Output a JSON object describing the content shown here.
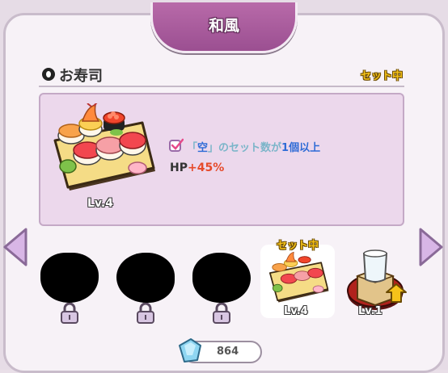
{
  "header": {
    "title": "和風"
  },
  "section": {
    "title": "お寿司",
    "status_badge": "セット中"
  },
  "detail": {
    "level": "Lv.4",
    "condition_open": "「",
    "condition_key": "空",
    "condition_mid": "」のセット数が",
    "condition_count": "1個以上",
    "bonus_label": "HP",
    "bonus_value": "+45%"
  },
  "items": [
    {
      "state": "locked"
    },
    {
      "state": "locked"
    },
    {
      "state": "locked"
    },
    {
      "state": "active",
      "label": "セット中",
      "level": "Lv.4"
    },
    {
      "state": "available",
      "level": "Lv.1"
    }
  ],
  "currency": {
    "value": "864"
  },
  "colors": {
    "accent": "#9b4f91",
    "badge": "#f2c019",
    "bonus": "#e64a2a",
    "highlight": "#2e6bd6"
  }
}
